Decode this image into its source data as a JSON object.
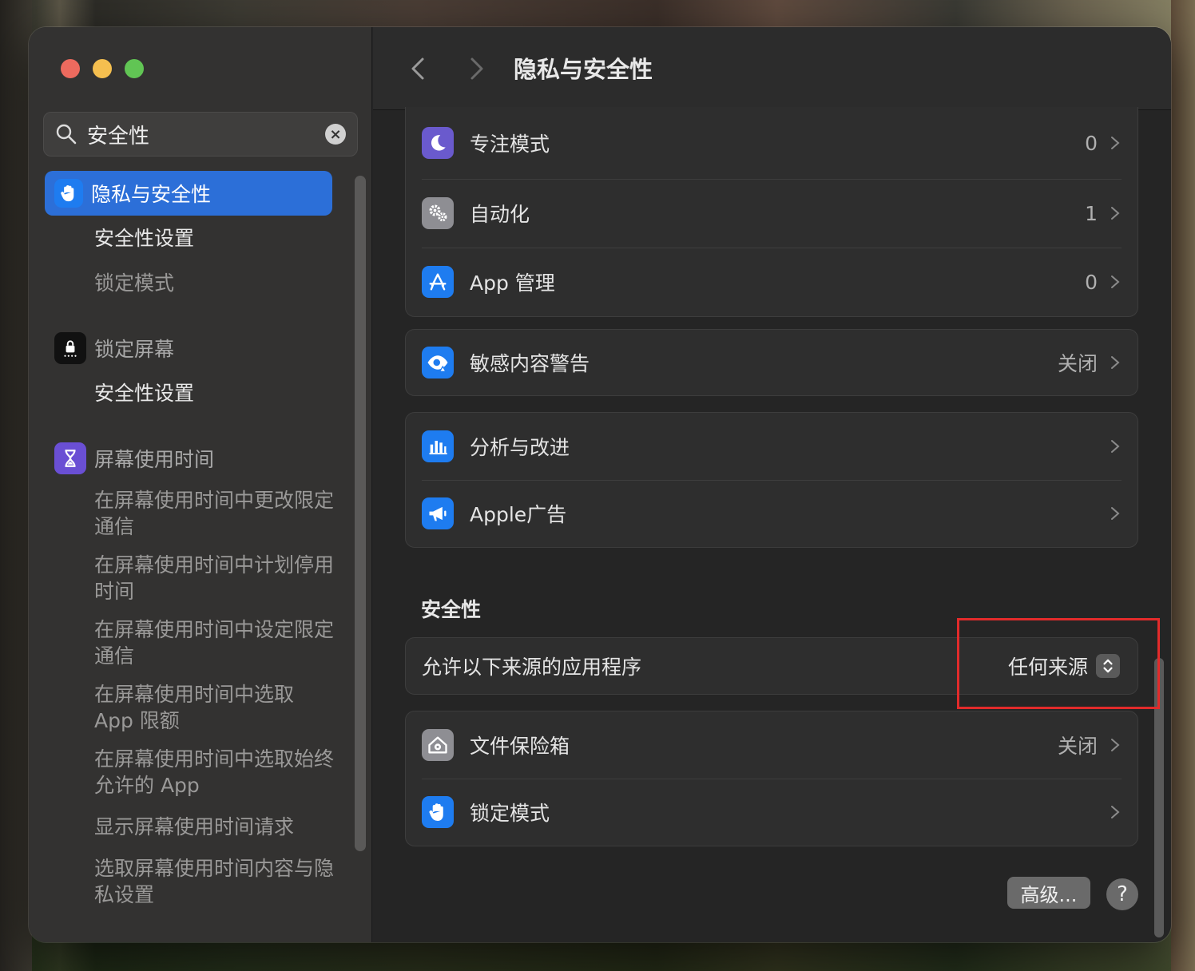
{
  "window": {
    "title": "隐私与安全性"
  },
  "search": {
    "value": "安全性",
    "clear_icon": "×"
  },
  "sidebar": {
    "selected": {
      "label": "隐私与安全性",
      "icon": "hand-icon",
      "color": "#2c6fd8"
    },
    "items": [
      {
        "label": "安全性设置"
      },
      {
        "label": "锁定模式"
      },
      {
        "label": "锁定屏幕",
        "icon": "lock-screen-icon"
      },
      {
        "label": "安全性设置"
      },
      {
        "label": "屏幕使用时间",
        "icon": "hourglass-icon"
      },
      {
        "label": "在屏幕使用时间中更改限定通信"
      },
      {
        "label": "在屏幕使用时间中计划停用时间"
      },
      {
        "label": "在屏幕使用时间中设定限定通信"
      },
      {
        "label": "在屏幕使用时间中选取 App 限额"
      },
      {
        "label": "在屏幕使用时间中选取始终允许的 App"
      },
      {
        "label": "显示屏幕使用时间请求"
      },
      {
        "label": "选取屏幕使用时间内容与隐私设置"
      }
    ]
  },
  "groups": {
    "g1": [
      {
        "label": "专注模式",
        "value": "0",
        "icon": "moon-icon",
        "color": "#6a5acd"
      },
      {
        "label": "自动化",
        "value": "1",
        "icon": "gears-icon",
        "color": "#8e8e93"
      },
      {
        "label": "App 管理",
        "value": "0",
        "icon": "app-store-icon",
        "color": "#1e7cf0"
      }
    ],
    "g2": [
      {
        "label": "敏感内容警告",
        "value": "关闭",
        "icon": "eye-warning-icon",
        "color": "#1e7cf0"
      }
    ],
    "g3": [
      {
        "label": "分析与改进",
        "value": "",
        "icon": "chart-icon",
        "color": "#1e7cf0"
      },
      {
        "label": "Apple广告",
        "value": "",
        "icon": "megaphone-icon",
        "color": "#1e7cf0"
      }
    ],
    "g5": [
      {
        "label": "文件保险箱",
        "value": "关闭",
        "icon": "house-lock-icon",
        "color": "#8e8e93"
      },
      {
        "label": "锁定模式",
        "value": "",
        "icon": "hand-icon",
        "color": "#1e7cf0"
      }
    ]
  },
  "security": {
    "section_title": "安全性",
    "allow_label": "允许以下来源的应用程序",
    "allow_value": "任何来源"
  },
  "buttons": {
    "advanced": "高级...",
    "help": "?"
  }
}
